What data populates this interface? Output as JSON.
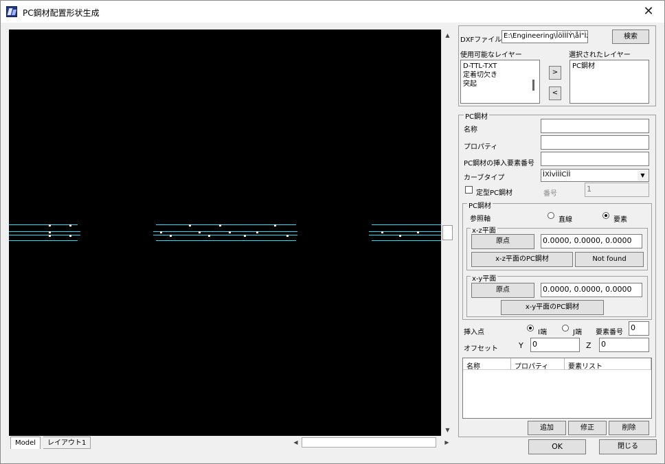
{
  "window": {
    "title": "PC鋼材配置形状生成",
    "close": "✕"
  },
  "viewport": {
    "tabs": [
      "Model",
      "レイアウト1"
    ]
  },
  "dxf": {
    "file_label": "DXFファイル",
    "file_value": "E:\\Engineering\\ÎöÌÌÍÝ\\åÍ\"ÌzÌuÌÌ",
    "browse": "検索",
    "available_label": "使用可能なレイヤー",
    "selected_label": "選択されたレイヤー",
    "available": [
      "D-TTL-TXT",
      "定着切欠き",
      "突起"
    ],
    "selected": [
      "PC鋼材"
    ],
    "add_arrow": ">",
    "remove_arrow": "<"
  },
  "pc": {
    "group": "PC鋼材",
    "name_label": "名称",
    "prop_label": "プロパティ",
    "insert_label": "PC鋼材の挿入要素番号",
    "curve_label": "カーブタイプ",
    "curve_value": "ÌXÌvÌÌÌCÌÌ",
    "fixed_label": "定型PC鋼材",
    "number_label": "番号",
    "number_value": "1"
  },
  "pc_inner": {
    "group": "PC鋼材",
    "axis_label": "参照軸",
    "axis_line": "直線",
    "axis_elem": "要素",
    "xz_group": "x-z平面",
    "xz_origin_btn": "原点",
    "xz_origin_value": "0.0000, 0.0000, 0.0000",
    "xz_pc_btn": "x-z平面のPC鋼材",
    "xz_status": "Not found",
    "xy_group": "x-y平面",
    "xy_origin_btn": "原点",
    "xy_origin_value": "0.0000, 0.0000, 0.0000",
    "xy_pc_btn": "x-y平面のPC鋼材"
  },
  "insert": {
    "label": "挿入点",
    "i_end": "I端",
    "j_end": "J端",
    "elem_no_label": "要素番号",
    "elem_no": "0",
    "offset_label": "オフセット",
    "y_label": "Y",
    "y_value": "0",
    "z_label": "Z",
    "z_value": "0"
  },
  "table": {
    "headers": [
      "名称",
      "プロパティ",
      "要素リスト"
    ]
  },
  "actions": {
    "add": "追加",
    "modify": "修正",
    "delete": "削除",
    "ok": "OK",
    "close": "閉じる"
  }
}
